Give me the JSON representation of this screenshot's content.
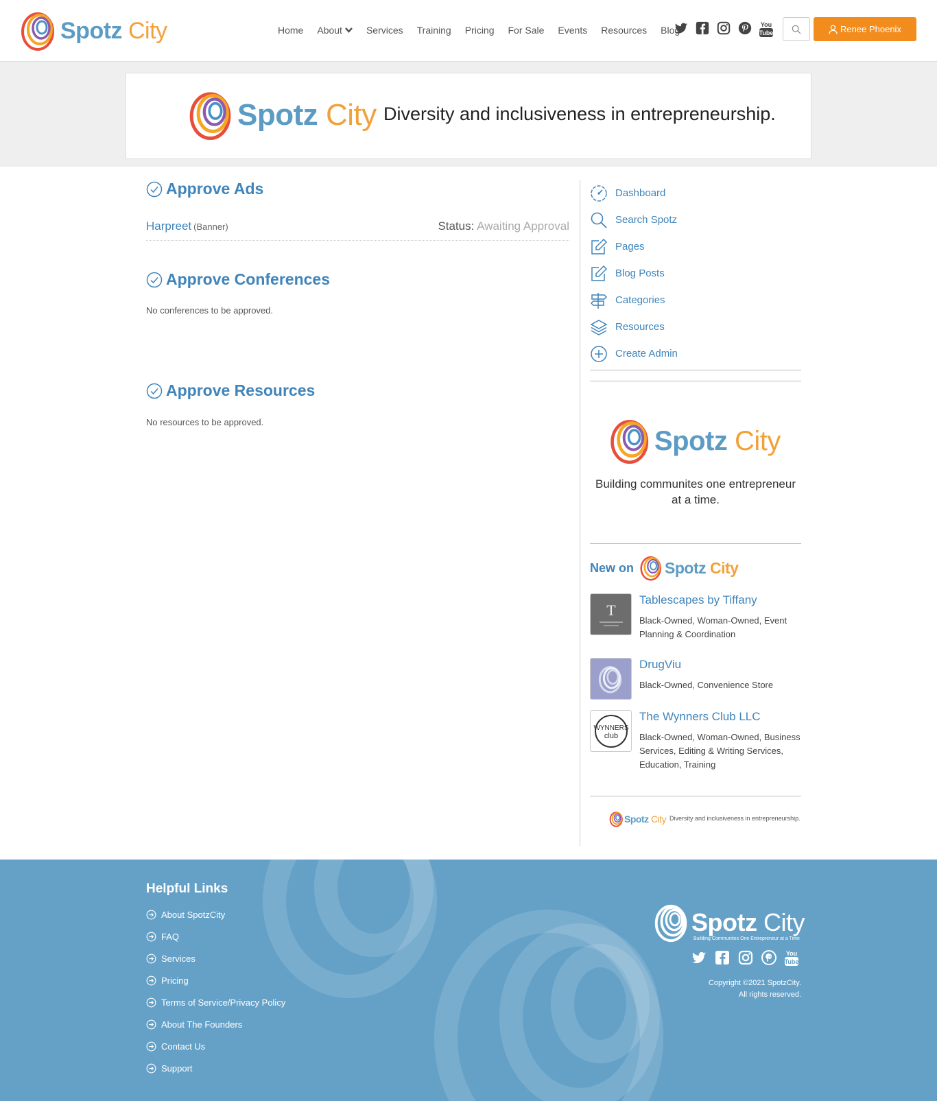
{
  "brand": {
    "spotz": "Spotz",
    "city": "City",
    "logo_tagline": "Building Communites One Entrepreneur at a Time"
  },
  "nav": {
    "items": [
      "Home",
      "About",
      "Services",
      "Training",
      "Pricing",
      "For Sale",
      "Events",
      "Resources",
      "Blog"
    ]
  },
  "header": {
    "socials": [
      "twitter-icon",
      "facebook-icon",
      "instagram-icon",
      "pinterest-icon",
      "youtube-icon"
    ],
    "user_button": "Renee Phoenix"
  },
  "banner": {
    "tagline": "Diversity and inclusiveness in entrepreneurship."
  },
  "main": {
    "approve_ads": {
      "title": "Approve Ads",
      "rows": [
        {
          "name": "Harpreet",
          "type": "(Banner)",
          "status_label": "Status:",
          "status_value": "Awaiting Approval"
        }
      ]
    },
    "approve_conferences": {
      "title": "Approve Conferences",
      "empty": "No conferences to be approved."
    },
    "approve_resources": {
      "title": "Approve Resources",
      "empty": "No resources to be approved."
    }
  },
  "sidebar": {
    "menu": [
      {
        "label": "Dashboard",
        "icon": "dashboard-icon"
      },
      {
        "label": "Search Spotz",
        "icon": "search-icon"
      },
      {
        "label": "Pages",
        "icon": "edit-icon"
      },
      {
        "label": "Blog Posts",
        "icon": "edit-icon"
      },
      {
        "label": "Categories",
        "icon": "signpost-icon"
      },
      {
        "label": "Resources",
        "icon": "layers-icon"
      },
      {
        "label": "Create Admin",
        "icon": "plus-circle-icon"
      }
    ],
    "promo_text": "Building communites one entrepreneur at a time.",
    "new_on_label": "New on",
    "businesses": [
      {
        "name": "Tablescapes by Tiffany",
        "tags": "Black-Owned, Woman-Owned, Event Planning & Coordination"
      },
      {
        "name": "DrugViu",
        "tags": "Black-Owned, Convenience Store"
      },
      {
        "name": "The Wynners Club LLC",
        "tags": "Black-Owned, Woman-Owned, Business Services, Editing & Writing Services, Education, Training"
      }
    ],
    "mini_banner_tagline": "Diversity and inclusiveness in entrepreneurship."
  },
  "footer": {
    "title": "Helpful Links",
    "links": [
      "About SpotzCity",
      "FAQ",
      "Services",
      "Pricing",
      "Terms of Service/Privacy Policy",
      "About The Founders",
      "Contact Us",
      "Support"
    ],
    "copyright_line1": "Copyright ©2021 SpotzCity.",
    "copyright_line2": "All rights reserved."
  },
  "colors": {
    "accent": "#3f84ba",
    "orange": "#f28c1c",
    "footer_bg": "#65a1c7"
  }
}
